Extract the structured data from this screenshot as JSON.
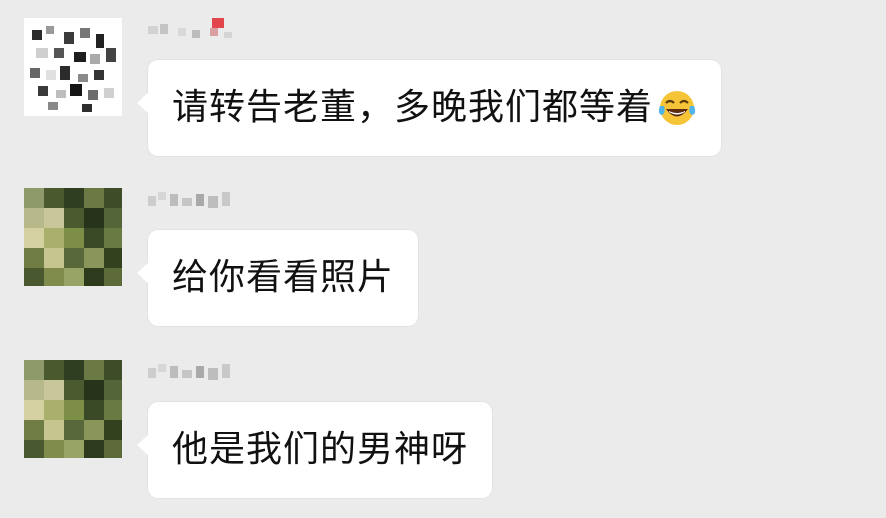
{
  "messages": [
    {
      "sender_avatar_icon": "pixelated-avatar-icon",
      "text": "请转告老董，多晚我们都等着",
      "emoji_icon": "tears-of-joy-emoji-icon"
    },
    {
      "sender_avatar_icon": "pixelated-photo-avatar-icon",
      "text": "给你看看照片"
    },
    {
      "sender_avatar_icon": "pixelated-photo-avatar-icon",
      "text": "他是我们的男神呀"
    }
  ],
  "colors": {
    "background": "#ebebeb",
    "bubble": "#ffffff",
    "text": "#111111"
  }
}
